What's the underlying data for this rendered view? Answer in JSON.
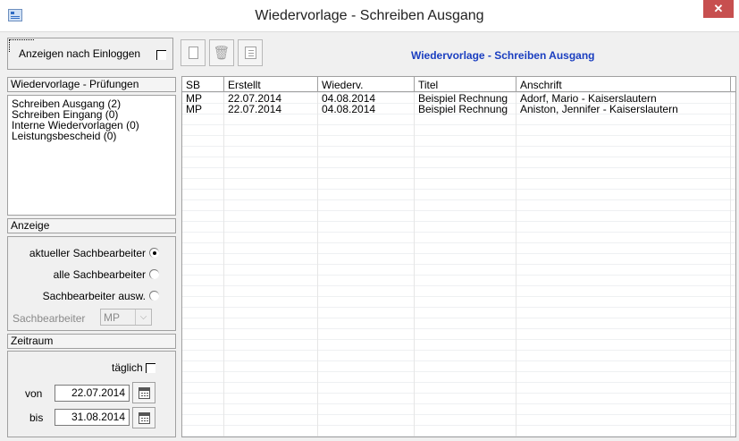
{
  "window": {
    "title": "Wiedervorlage - Schreiben Ausgang",
    "close_glyph": "✕"
  },
  "header": {
    "login_label": "Anzeigen nach Einloggen",
    "login_checked": false,
    "title": "Wiedervorlage - Schreiben Ausgang",
    "toolbar_icons": [
      "new-document-icon",
      "delete-icon",
      "edit-icon"
    ]
  },
  "pruefungen": {
    "title": "Wiedervorlage - Prüfungen",
    "items": [
      "Schreiben Ausgang (2)",
      "Schreiben Eingang (0)",
      "Interne Wiedervorlagen (0)",
      "Leistungsbescheid (0)"
    ]
  },
  "anzeige": {
    "title": "Anzeige",
    "options": [
      "aktueller Sachbearbeiter",
      "alle Sachbearbeiter",
      "Sachbearbeiter ausw."
    ],
    "selected": "aktueller Sachbearbeiter",
    "sachbearbeiter_label": "Sachbearbeiter",
    "sachbearbeiter_value": "MP"
  },
  "zeitraum": {
    "title": "Zeitraum",
    "taeglich_label": "täglich",
    "taeglich_checked": false,
    "von_label": "von",
    "von_value": "22.07.2014",
    "bis_label": "bis",
    "bis_value": "31.08.2014"
  },
  "table": {
    "columns": [
      "SB",
      "Erstellt",
      "Wiederv.",
      "Titel",
      "Anschrift"
    ],
    "rows": [
      [
        "MP",
        "22.07.2014",
        "04.08.2014",
        "Beispiel Rechnung",
        "Adorf, Mario - Kaiserslautern"
      ],
      [
        "MP",
        "22.07.2014",
        "04.08.2014",
        "Beispiel Rechnung",
        "Aniston, Jennifer - Kaiserslautern"
      ]
    ]
  },
  "colors": {
    "header_title": "#1a3ec0",
    "close_button": "#c74f4f"
  }
}
